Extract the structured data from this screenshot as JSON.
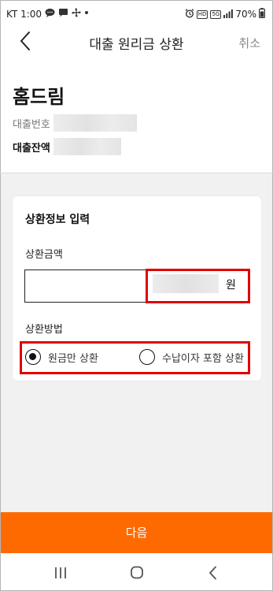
{
  "status_bar": {
    "time": "KT 1:00",
    "battery": "70%",
    "badge_hd": "HD",
    "badge_5g": "5G"
  },
  "header": {
    "title": "대출 원리금 상환",
    "cancel_label": "취소"
  },
  "account": {
    "name": "홈드림",
    "loan_number_label": "대출번호",
    "loan_balance_label": "대출잔액"
  },
  "form": {
    "title": "상환정보 입력",
    "amount_label": "상환금액",
    "amount_unit": "원",
    "method_label": "상환방법",
    "options": [
      {
        "label": "원금만 상환",
        "selected": true
      },
      {
        "label": "수납이자 포함 상환",
        "selected": false
      }
    ],
    "accent_color": "#ff6a00",
    "highlight_color": "#e00000"
  },
  "next_label": "다음"
}
